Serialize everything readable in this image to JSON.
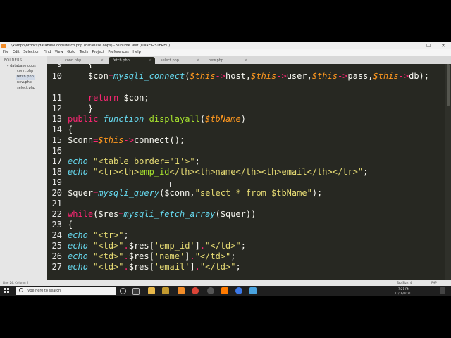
{
  "window": {
    "title": "C:\\xampp\\htdocs\\database oops\\fetch.php (database oops) - Sublime Text (UNREGISTERED)",
    "min": "—",
    "max": "☐",
    "close": "✕"
  },
  "menu": [
    "File",
    "Edit",
    "Selection",
    "Find",
    "View",
    "Goto",
    "Tools",
    "Project",
    "Preferences",
    "Help"
  ],
  "sidebar": {
    "heading": "FOLDERS",
    "folder": "database oops",
    "files": [
      "conn.php",
      "fetch.php",
      "new.php",
      "select.php"
    ]
  },
  "tabs": [
    {
      "label": "conn.php",
      "close": "×"
    },
    {
      "label": "fetch.php",
      "close": "×"
    },
    {
      "label": "select.php",
      "close": "×"
    },
    {
      "label": "new.php",
      "close": "×"
    }
  ],
  "editor": {
    "line_numbers": [
      "9",
      "10",
      "",
      "11",
      "12",
      "13",
      "14",
      "15",
      "16",
      "17",
      "18",
      "19",
      "20",
      "21",
      "22",
      "23",
      "24",
      "25",
      "26",
      "27"
    ]
  },
  "status": {
    "left": "Line 24, Column 2",
    "tab": "Tab Size: 4",
    "syntax": "PHP"
  },
  "taskbar": {
    "search_placeholder": "Type here to search",
    "time": "7:21 PM",
    "date": "11/16/2021"
  },
  "colors": {
    "editor_bg": "#272822",
    "keyword": "#f92672",
    "function": "#66d9ef",
    "entity": "#a6e22e",
    "variable": "#fd971f",
    "string": "#e6db74"
  }
}
